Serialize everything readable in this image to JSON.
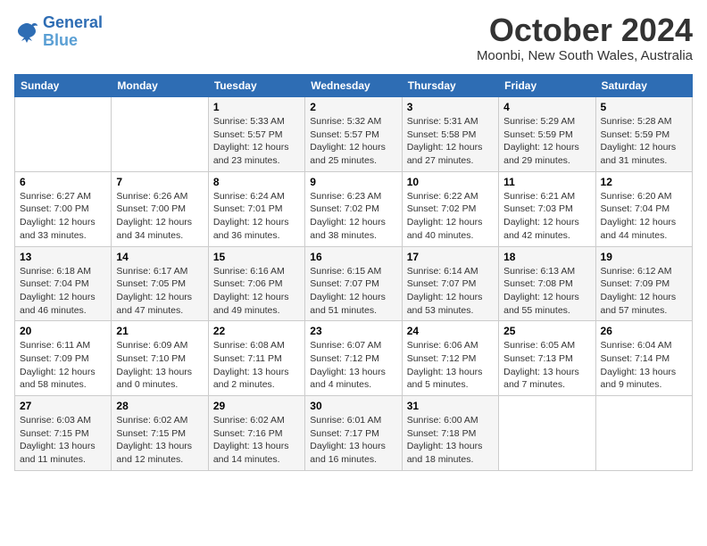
{
  "logo": {
    "line1": "General",
    "line2": "Blue"
  },
  "title": "October 2024",
  "subtitle": "Moonbi, New South Wales, Australia",
  "days_header": [
    "Sunday",
    "Monday",
    "Tuesday",
    "Wednesday",
    "Thursday",
    "Friday",
    "Saturday"
  ],
  "weeks": [
    [
      {
        "day": "",
        "detail": ""
      },
      {
        "day": "",
        "detail": ""
      },
      {
        "day": "1",
        "detail": "Sunrise: 5:33 AM\nSunset: 5:57 PM\nDaylight: 12 hours and 23 minutes."
      },
      {
        "day": "2",
        "detail": "Sunrise: 5:32 AM\nSunset: 5:57 PM\nDaylight: 12 hours and 25 minutes."
      },
      {
        "day": "3",
        "detail": "Sunrise: 5:31 AM\nSunset: 5:58 PM\nDaylight: 12 hours and 27 minutes."
      },
      {
        "day": "4",
        "detail": "Sunrise: 5:29 AM\nSunset: 5:59 PM\nDaylight: 12 hours and 29 minutes."
      },
      {
        "day": "5",
        "detail": "Sunrise: 5:28 AM\nSunset: 5:59 PM\nDaylight: 12 hours and 31 minutes."
      }
    ],
    [
      {
        "day": "6",
        "detail": "Sunrise: 6:27 AM\nSunset: 7:00 PM\nDaylight: 12 hours and 33 minutes."
      },
      {
        "day": "7",
        "detail": "Sunrise: 6:26 AM\nSunset: 7:00 PM\nDaylight: 12 hours and 34 minutes."
      },
      {
        "day": "8",
        "detail": "Sunrise: 6:24 AM\nSunset: 7:01 PM\nDaylight: 12 hours and 36 minutes."
      },
      {
        "day": "9",
        "detail": "Sunrise: 6:23 AM\nSunset: 7:02 PM\nDaylight: 12 hours and 38 minutes."
      },
      {
        "day": "10",
        "detail": "Sunrise: 6:22 AM\nSunset: 7:02 PM\nDaylight: 12 hours and 40 minutes."
      },
      {
        "day": "11",
        "detail": "Sunrise: 6:21 AM\nSunset: 7:03 PM\nDaylight: 12 hours and 42 minutes."
      },
      {
        "day": "12",
        "detail": "Sunrise: 6:20 AM\nSunset: 7:04 PM\nDaylight: 12 hours and 44 minutes."
      }
    ],
    [
      {
        "day": "13",
        "detail": "Sunrise: 6:18 AM\nSunset: 7:04 PM\nDaylight: 12 hours and 46 minutes."
      },
      {
        "day": "14",
        "detail": "Sunrise: 6:17 AM\nSunset: 7:05 PM\nDaylight: 12 hours and 47 minutes."
      },
      {
        "day": "15",
        "detail": "Sunrise: 6:16 AM\nSunset: 7:06 PM\nDaylight: 12 hours and 49 minutes."
      },
      {
        "day": "16",
        "detail": "Sunrise: 6:15 AM\nSunset: 7:07 PM\nDaylight: 12 hours and 51 minutes."
      },
      {
        "day": "17",
        "detail": "Sunrise: 6:14 AM\nSunset: 7:07 PM\nDaylight: 12 hours and 53 minutes."
      },
      {
        "day": "18",
        "detail": "Sunrise: 6:13 AM\nSunset: 7:08 PM\nDaylight: 12 hours and 55 minutes."
      },
      {
        "day": "19",
        "detail": "Sunrise: 6:12 AM\nSunset: 7:09 PM\nDaylight: 12 hours and 57 minutes."
      }
    ],
    [
      {
        "day": "20",
        "detail": "Sunrise: 6:11 AM\nSunset: 7:09 PM\nDaylight: 12 hours and 58 minutes."
      },
      {
        "day": "21",
        "detail": "Sunrise: 6:09 AM\nSunset: 7:10 PM\nDaylight: 13 hours and 0 minutes."
      },
      {
        "day": "22",
        "detail": "Sunrise: 6:08 AM\nSunset: 7:11 PM\nDaylight: 13 hours and 2 minutes."
      },
      {
        "day": "23",
        "detail": "Sunrise: 6:07 AM\nSunset: 7:12 PM\nDaylight: 13 hours and 4 minutes."
      },
      {
        "day": "24",
        "detail": "Sunrise: 6:06 AM\nSunset: 7:12 PM\nDaylight: 13 hours and 5 minutes."
      },
      {
        "day": "25",
        "detail": "Sunrise: 6:05 AM\nSunset: 7:13 PM\nDaylight: 13 hours and 7 minutes."
      },
      {
        "day": "26",
        "detail": "Sunrise: 6:04 AM\nSunset: 7:14 PM\nDaylight: 13 hours and 9 minutes."
      }
    ],
    [
      {
        "day": "27",
        "detail": "Sunrise: 6:03 AM\nSunset: 7:15 PM\nDaylight: 13 hours and 11 minutes."
      },
      {
        "day": "28",
        "detail": "Sunrise: 6:02 AM\nSunset: 7:15 PM\nDaylight: 13 hours and 12 minutes."
      },
      {
        "day": "29",
        "detail": "Sunrise: 6:02 AM\nSunset: 7:16 PM\nDaylight: 13 hours and 14 minutes."
      },
      {
        "day": "30",
        "detail": "Sunrise: 6:01 AM\nSunset: 7:17 PM\nDaylight: 13 hours and 16 minutes."
      },
      {
        "day": "31",
        "detail": "Sunrise: 6:00 AM\nSunset: 7:18 PM\nDaylight: 13 hours and 18 minutes."
      },
      {
        "day": "",
        "detail": ""
      },
      {
        "day": "",
        "detail": ""
      }
    ]
  ]
}
